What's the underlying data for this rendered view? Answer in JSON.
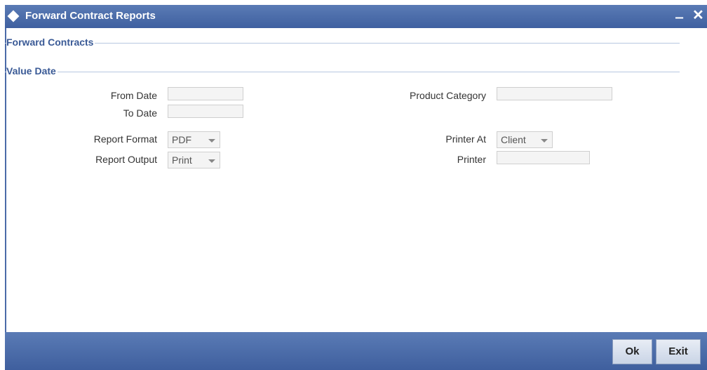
{
  "window": {
    "title": "Forward Contract Reports",
    "minimize_glyph": "‒",
    "close_glyph": "✕"
  },
  "sections": {
    "forward_contracts": "Forward Contracts",
    "value_date": "Value Date"
  },
  "fields": {
    "from_date": {
      "label": "From Date",
      "value": ""
    },
    "to_date": {
      "label": "To Date",
      "value": ""
    },
    "product_category": {
      "label": "Product Category",
      "value": ""
    },
    "report_format": {
      "label": "Report Format",
      "value": "PDF"
    },
    "report_output": {
      "label": "Report Output",
      "value": "Print"
    },
    "printer_at": {
      "label": "Printer At",
      "value": "Client"
    },
    "printer": {
      "label": "Printer",
      "value": ""
    }
  },
  "buttons": {
    "ok": "Ok",
    "exit": "Exit"
  },
  "colors": {
    "titlebar": "#4a6aa8",
    "section_text": "#3a5a96",
    "footer": "#4b6aa8"
  }
}
